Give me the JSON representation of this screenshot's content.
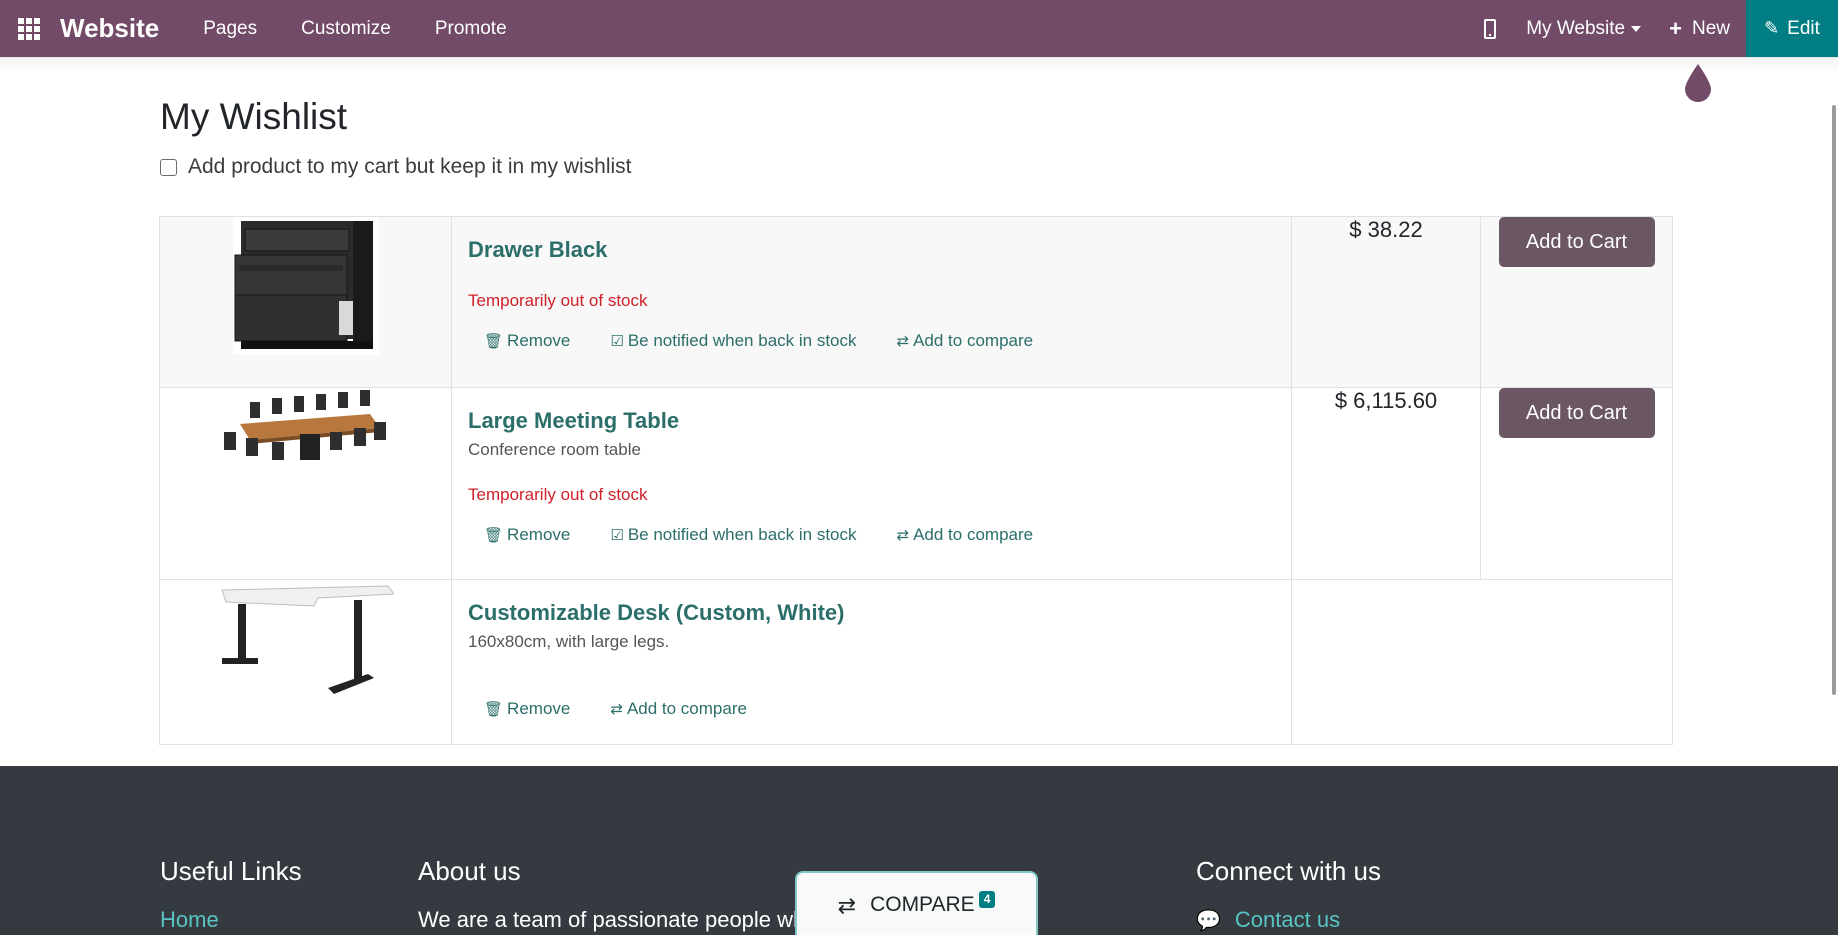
{
  "navbar": {
    "brand": "Website",
    "menu": [
      "Pages",
      "Customize",
      "Promote"
    ],
    "website_select": "My Website",
    "new_label": "New",
    "edit_label": "Edit",
    "color": "#714b67",
    "edit_color": "#017e84"
  },
  "page": {
    "title": "My Wishlist",
    "keep_label": "Add product to my cart but keep it in my wishlist",
    "keep_checked": false
  },
  "wishlist": [
    {
      "name": "Drawer Black",
      "description": "",
      "stock": "Temporarily out of stock",
      "price": "$ 38.22",
      "add_to_cart": "Add to Cart",
      "actions": [
        "Remove",
        "Be notified when back in stock",
        "Add to compare"
      ]
    },
    {
      "name": "Large Meeting Table",
      "description": "Conference room table",
      "stock": "Temporarily out of stock",
      "price": "$ 6,115.60",
      "add_to_cart": "Add to Cart",
      "actions": [
        "Remove",
        "Be notified when back in stock",
        "Add to compare"
      ]
    },
    {
      "name": "Customizable Desk (Custom, White)",
      "description": "160x80cm, with large legs.",
      "stock": "",
      "price": "",
      "add_to_cart": "",
      "actions": [
        "Remove",
        "Add to compare"
      ]
    }
  ],
  "footer": {
    "useful_links_title": "Useful Links",
    "useful_links_first": "Home",
    "about_title": "About us",
    "about_text": "We are a team of passionate people whose goal is to improve",
    "connect_title": "Connect with us",
    "contact_link": "Contact us"
  },
  "compare": {
    "label": "COMPARE",
    "count": "4"
  }
}
